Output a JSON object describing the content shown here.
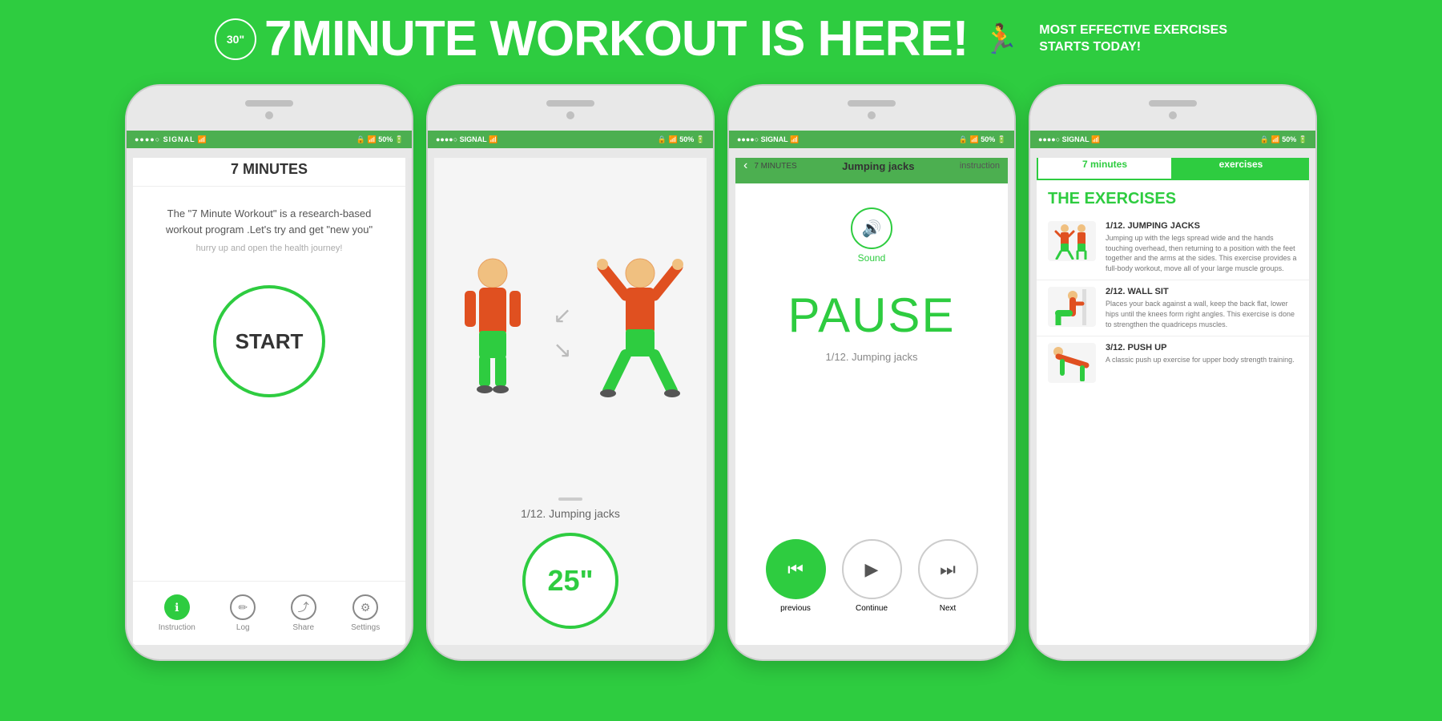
{
  "header": {
    "badge": "30\"",
    "title": "7MINUTE WORKOUT IS HERE!",
    "subtitle_line1": "MOST EFFECTIVE EXERCISES",
    "subtitle_line2": "STARTS TODAY!"
  },
  "phone1": {
    "title": "7 MINUTES",
    "description": "The \"7 Minute Workout\" is a research-based workout program .Let's try and get \"new you\"",
    "subtitle": "hurry up and open the health journey!",
    "start_label": "START",
    "nav_items": [
      {
        "label": "Instruction",
        "icon": "ℹ"
      },
      {
        "label": "Log",
        "icon": "✏"
      },
      {
        "label": "Share",
        "icon": "⤴"
      },
      {
        "label": "Settings",
        "icon": "⚙"
      }
    ]
  },
  "phone2": {
    "exercise_label": "1/12. Jumping jacks",
    "timer": "25\""
  },
  "phone3": {
    "back_label": "7 MINUTES",
    "exercise_name": "Jumping jacks",
    "instruction_label": "instruction",
    "sound_label": "Sound",
    "pause_text": "PAUSE",
    "exercise_counter": "1/12. Jumping jacks",
    "btn_previous": "previous",
    "btn_continue": "Continue",
    "btn_next": "Next"
  },
  "phone4": {
    "tab_active": "7 minutes",
    "tab_inactive": "exercises",
    "section_title": "THE EXERCISES",
    "exercises": [
      {
        "number": "1/12.",
        "name": "JUMPING JACKS",
        "description": "Jumping up with the legs spread wide and the hands touching overhead, then returning to a position with the feet together and the arms at the sides. This exercise provides a full-body workout, move all of your large muscle groups."
      },
      {
        "number": "2/12.",
        "name": "WALL SIT",
        "description": "Places your back against a wall, keep the back flat, lower hips until the knees form right angles. This exercise is done to strengthen the quadriceps muscles."
      },
      {
        "number": "3/12.",
        "name": "PUSH UP",
        "description": "A classic push up exercise for upper body strength training."
      }
    ]
  },
  "colors": {
    "green": "#2ecc40",
    "green_dark": "#27ae60",
    "status_green": "#4caf50"
  }
}
